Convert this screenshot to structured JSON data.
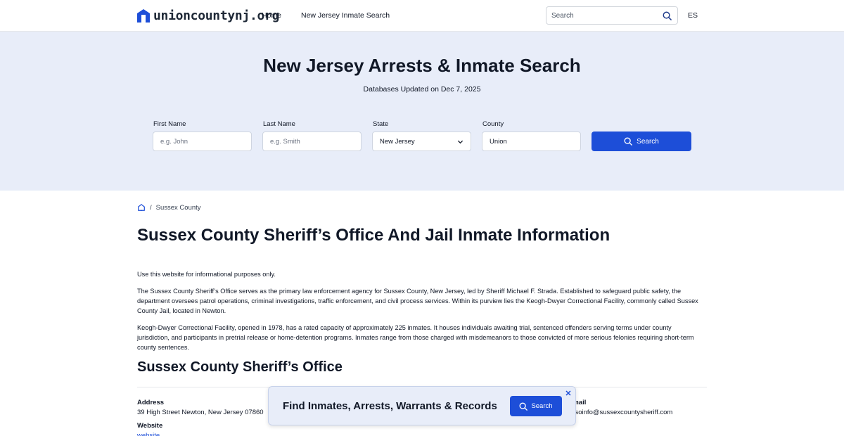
{
  "header": {
    "logo_text": "unioncountynj.org",
    "nav": [
      "Home",
      "New Jersey Inmate Search"
    ],
    "search_placeholder": "Search",
    "lang": "ES"
  },
  "hero": {
    "title": "New Jersey Arrests & Inmate Search",
    "subtitle": "Databases Updated on Dec 7, 2025",
    "fields": {
      "first_name": {
        "label": "First Name",
        "placeholder": "e.g. John"
      },
      "last_name": {
        "label": "Last Name",
        "placeholder": "e.g. Smith"
      },
      "state": {
        "label": "State",
        "value": "New Jersey"
      },
      "county": {
        "label": "County",
        "value": "Union"
      }
    },
    "search_button": "Search"
  },
  "breadcrumb": {
    "separator": "/",
    "current": "Sussex County"
  },
  "content": {
    "title": "Sussex County Sheriff’s Office And Jail Inmate Information",
    "paragraphs": [
      "Use this website for informational purposes only.",
      "The Sussex County Sheriff’s Office serves as the primary law enforcement agency for Sussex County, New Jersey, led by Sheriff Michael F. Strada. Established to safeguard public safety, the department oversees patrol operations, criminal investigations, traffic enforcement, and civil process services. Within its purview lies the Keogh-Dwyer Correctional Facility, commonly called Sussex County Jail, located in Newton.",
      "Keogh-Dwyer Correctional Facility, opened in 1978, has a rated capacity of approximately 225 inmates. It houses individuals awaiting trial, sentenced offenders serving terms under county jurisdiction, and participants in pretrial release or home-detention programs. Inmates range from those charged with misdemeanors to those convicted of more serious felonies requiring short-term county sentences."
    ],
    "section_title": "Sussex County Sheriff’s Office",
    "info": {
      "address_label": "Address",
      "address_value": "39 High Street Newton, New Jersey 07860",
      "website_label": "Website",
      "website_value": "website",
      "email_label": "Email",
      "email_value": "scsoinfo@sussexcountysheriff.com"
    }
  },
  "banner": {
    "text": "Find Inmates, Arrests, Warrants & Records",
    "button": "Search"
  },
  "colors": {
    "accent": "#1d4ed8",
    "hero_bg": "#e8edf9"
  }
}
